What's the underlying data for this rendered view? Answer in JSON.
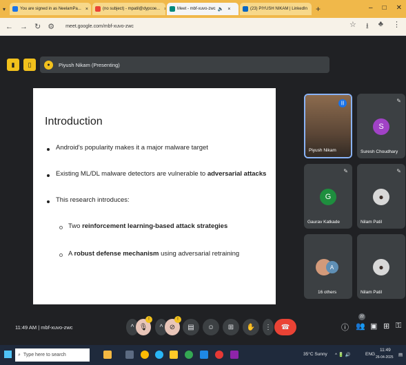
{
  "browser": {
    "tabs": [
      {
        "label": "You are signed in as NeelamPa...",
        "active": false
      },
      {
        "label": "(no subject) - mpatil@dypcoe...",
        "active": false
      },
      {
        "label": "Meet - mbf-xuvo-zwc",
        "active": true
      },
      {
        "label": "(23) PIYUSH NIKAM | LinkedIn",
        "active": false
      }
    ],
    "url": "meet.google.com/mbf-xuvo-zwc"
  },
  "meet": {
    "presenting_label": "Piyush Nikam (Presenting)",
    "time": "11:49 AM",
    "separator": "|",
    "meeting_code": "mbf-xuvo-zwc",
    "participant_count": "22",
    "mute_badge": "!",
    "cam_badge": "!"
  },
  "slide": {
    "title": "Introduction",
    "b1": "Android's popularity makes it a major malware target",
    "b2_pre": "Existing ML/DL malware detectors are vulnerable to ",
    "b2_bold": "adversarial attacks",
    "b3": "This research introduces:",
    "s1_pre": "Two ",
    "s1_bold": "reinforcement learning-based attack strategies",
    "s2_pre": "A ",
    "s2_bold": "robust defense mechanism",
    "s2_post": " using adversarial retraining"
  },
  "participants": [
    {
      "name": "Piyush Nikam",
      "initial": "",
      "color": ""
    },
    {
      "name": "Suresh Choudhary",
      "initial": "S",
      "color": "#a142c6"
    },
    {
      "name": "Gaurav Katkade",
      "initial": "G",
      "color": "#1e8e3e"
    },
    {
      "name": "Nilam Patil",
      "initial": "",
      "color": ""
    },
    {
      "name": "16 others",
      "initial": "A",
      "color": "#5f8fb5"
    },
    {
      "name": "Nilam Patil",
      "initial": "",
      "color": ""
    }
  ],
  "taskbar": {
    "search_placeholder": "Type here to search",
    "weather": "35°C  Sunny",
    "lang": "ENG",
    "clock_time": "11:49",
    "clock_date": "26-04-2025"
  }
}
